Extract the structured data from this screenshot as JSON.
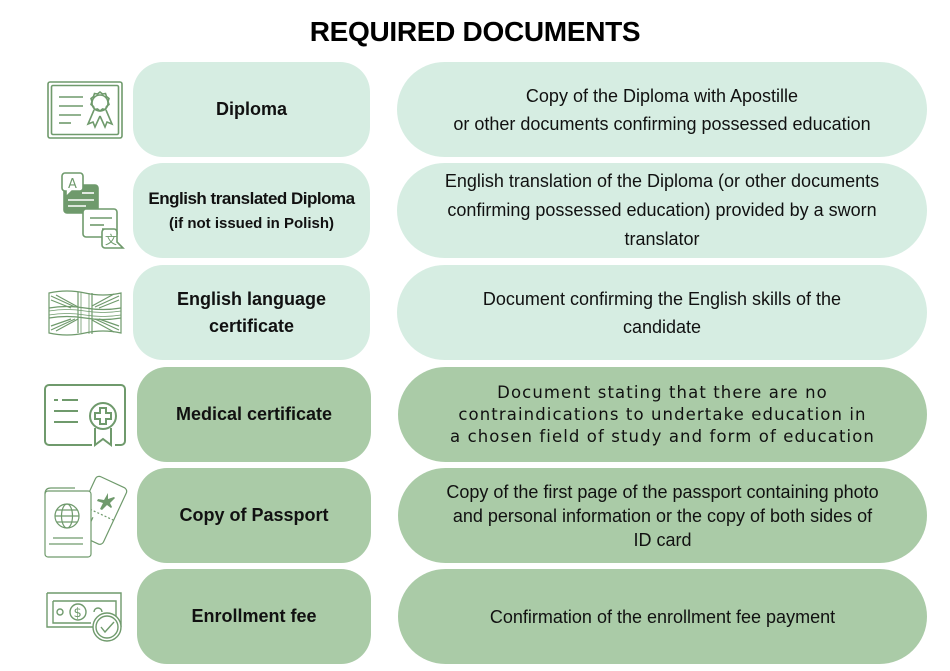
{
  "title": "REQUIRED DOCUMENTS",
  "colors": {
    "light_box": "#d6ede2",
    "dark_box": "#aacba7",
    "icon_stroke": "#6f9a6c"
  },
  "rows": [
    {
      "icon": "diploma-certificate-icon",
      "label": "Diploma",
      "sublabel": "",
      "description_lines": [
        "Copy of the Diploma with Apostille",
        "or other documents confirming possessed education"
      ],
      "shade": "light"
    },
    {
      "icon": "translation-bubbles-icon",
      "label": "English translated Diploma",
      "sublabel": "(if not issued in Polish)",
      "description_lines": [
        "English translation of the Diploma (or other documents",
        "confirming possessed education) provided by a sworn",
        "translator"
      ],
      "shade": "light"
    },
    {
      "icon": "uk-flag-icon",
      "label_lines": [
        "English language",
        "certificate"
      ],
      "description_lines": [
        "Document confirming the English skills of the",
        "candidate"
      ],
      "shade": "light"
    },
    {
      "icon": "medical-certificate-icon",
      "label": "Medical certificate",
      "description_lines": [
        "Document stating that there are no",
        "contraindications to undertake education in",
        "a chosen field of study and form of education"
      ],
      "shade": "dark"
    },
    {
      "icon": "passport-ticket-icon",
      "label": "Copy of Passport",
      "description_lines": [
        "Copy of the first page of the passport containing photo",
        "and personal information or the copy of both sides of",
        "ID card"
      ],
      "shade": "dark"
    },
    {
      "icon": "money-check-icon",
      "label": "Enrollment fee",
      "description_lines": [
        "Confirmation of the enrollment fee payment"
      ],
      "shade": "dark"
    }
  ]
}
